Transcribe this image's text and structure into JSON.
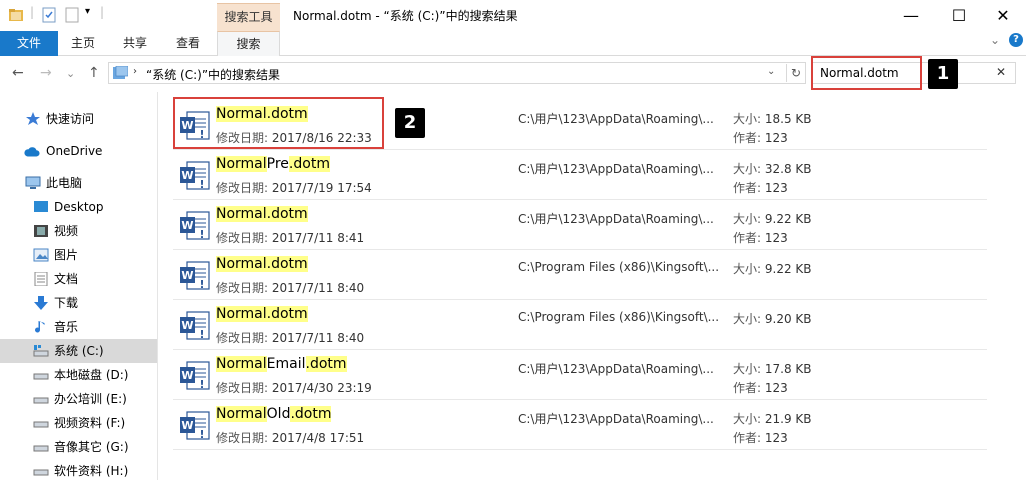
{
  "window": {
    "title": "Normal.dotm - “系统 (C:)”中的搜索结果",
    "context_tab_group": "搜索工具",
    "minimize": "—",
    "maximize": "☐",
    "close": "✕"
  },
  "ribbon": {
    "tabs": [
      {
        "label": "文件"
      },
      {
        "label": "主页"
      },
      {
        "label": "共享"
      },
      {
        "label": "查看"
      },
      {
        "label": "搜索"
      }
    ],
    "collapse": "⌄",
    "help": "?"
  },
  "nav": {
    "back": "←",
    "forward": "→",
    "recent": "⌄",
    "up": "↑",
    "address_sep": "›",
    "address_path": "“系统 (C:)”中的搜索结果",
    "address_dropdown": "⌄",
    "refresh": "↻",
    "search_value": "Normal.dotm",
    "search_clear": "✕"
  },
  "callouts": {
    "one": "1",
    "two": "2"
  },
  "sidebar": {
    "items": [
      {
        "label": "快速访问",
        "icon": "star-icon"
      },
      {
        "label": "OneDrive",
        "icon": "cloud-icon"
      },
      {
        "label": "此电脑",
        "icon": "computer-icon"
      },
      {
        "label": "Desktop",
        "icon": "desktop-icon"
      },
      {
        "label": "视频",
        "icon": "video-icon"
      },
      {
        "label": "图片",
        "icon": "picture-icon"
      },
      {
        "label": "文档",
        "icon": "document-icon"
      },
      {
        "label": "下载",
        "icon": "download-icon"
      },
      {
        "label": "音乐",
        "icon": "music-icon"
      },
      {
        "label": "系统 (C:)",
        "icon": "drive-icon"
      },
      {
        "label": "本地磁盘 (D:)",
        "icon": "drive-icon"
      },
      {
        "label": "办公培训 (E:)",
        "icon": "drive-icon"
      },
      {
        "label": "视频资料 (F:)",
        "icon": "drive-icon"
      },
      {
        "label": "音像其它 (G:)",
        "icon": "drive-icon"
      },
      {
        "label": "软件资料 (H:)",
        "icon": "drive-icon"
      }
    ]
  },
  "results": {
    "date_label": "修改日期:",
    "size_label": "大小:",
    "author_label": "作者:",
    "rows": [
      {
        "name_parts": [
          "Normal.dotm",
          "",
          ""
        ],
        "date": "2017/8/16 22:33",
        "path": "C:\\用户\\123\\AppData\\Roaming\\...",
        "size": "18.5 KB",
        "author": "123"
      },
      {
        "name_parts": [
          "Normal",
          "Pre",
          ".dotm"
        ],
        "date": "2017/7/19 17:54",
        "path": "C:\\用户\\123\\AppData\\Roaming\\...",
        "size": "32.8 KB",
        "author": "123"
      },
      {
        "name_parts": [
          "Normal.dotm",
          "",
          ""
        ],
        "date": "2017/7/11 8:41",
        "path": "C:\\用户\\123\\AppData\\Roaming\\...",
        "size": "9.22 KB",
        "author": "123"
      },
      {
        "name_parts": [
          "Normal.dotm",
          "",
          ""
        ],
        "date": "2017/7/11 8:40",
        "path": "C:\\Program Files (x86)\\Kingsoft\\...",
        "size": "9.22 KB",
        "author": ""
      },
      {
        "name_parts": [
          "Normal.dotm",
          "",
          ""
        ],
        "date": "2017/7/11 8:40",
        "path": "C:\\Program Files (x86)\\Kingsoft\\...",
        "size": "9.20 KB",
        "author": ""
      },
      {
        "name_parts": [
          "Normal",
          "Email",
          ".dotm"
        ],
        "date": "2017/4/30 23:19",
        "path": "C:\\用户\\123\\AppData\\Roaming\\...",
        "size": "17.8 KB",
        "author": "123"
      },
      {
        "name_parts": [
          "Normal",
          "Old",
          ".dotm"
        ],
        "date": "2017/4/8 17:51",
        "path": "C:\\用户\\123\\AppData\\Roaming\\...",
        "size": "21.9 KB",
        "author": "123"
      }
    ]
  },
  "colors": {
    "accent": "#1979ca",
    "highlight": "#ffff8a",
    "callout_box": "#d9413b"
  }
}
